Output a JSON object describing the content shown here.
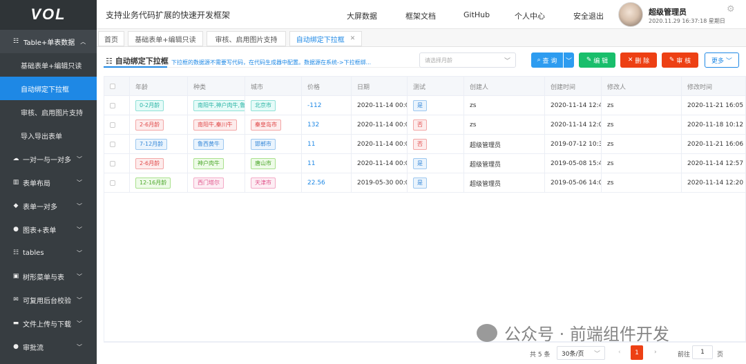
{
  "logo": "VOL",
  "sidebar": {
    "group": {
      "label": "Table+单表数据",
      "icon": "grid-icon"
    },
    "subitems": [
      "基础表单+编辑只读",
      "自动绑定下拉框",
      "审核、启用图片支持",
      "导入导出表单"
    ],
    "active_subitem": "自动绑定下拉框",
    "items": [
      {
        "label": "一对一与一对多",
        "icon": "cloud-icon"
      },
      {
        "label": "表单布局",
        "icon": "bar-chart-icon"
      },
      {
        "label": "表单一对多",
        "icon": "cube-icon"
      },
      {
        "label": "图表+表单",
        "icon": "circle-icon"
      },
      {
        "label": "tables",
        "icon": "grid-icon"
      },
      {
        "label": "树形菜单与表",
        "icon": "image-icon"
      },
      {
        "label": "可复用后台校验",
        "icon": "chat-icon"
      },
      {
        "label": "文件上传与下载",
        "icon": "folder-icon"
      },
      {
        "label": "审批流",
        "icon": "circle-icon"
      }
    ]
  },
  "header": {
    "slogan": "支持业务代码扩展的快速开发框架",
    "nav": [
      "大屏数据",
      "框架文档",
      "GitHub",
      "个人中心",
      "安全退出"
    ],
    "user_name": "超级管理员",
    "datetime": "2020.11.29 16:37:18 星期日"
  },
  "tabs": [
    {
      "label": "首页",
      "closable": false
    },
    {
      "label": "基础表单+编辑只读",
      "closable": false
    },
    {
      "label": "审核、启用图片支持",
      "closable": false
    },
    {
      "label": "自动绑定下拉框",
      "closable": true,
      "active": true
    }
  ],
  "page": {
    "title": "自动绑定下拉框",
    "description": "下拉框的数据源不需要写代码，在代码生成器中配置。数据源在系统->下拉框绑...",
    "month_placeholder": "请选择月龄"
  },
  "toolbar": {
    "search": "查 询",
    "edit": "编 辑",
    "delete": "删 除",
    "audit": "审 核",
    "more": "更多"
  },
  "colors": {
    "primary": "#1e88e5",
    "success": "#19be6b",
    "danger": "#ed4014",
    "sidebar_bg": "#373d41"
  },
  "table": {
    "columns": [
      "年龄",
      "种类",
      "城市",
      "价格",
      "日期",
      "测试",
      "创建人",
      "创建时间",
      "修改人",
      "修改时间"
    ],
    "rows": [
      {
        "age": "0-2月龄",
        "kind": "南阳牛,神户肉牛,鲁",
        "city": "北京市",
        "price": "-112",
        "date": "2020-11-14 00:00",
        "test": "是",
        "creator": "zs",
        "created": "2020-11-14 12:48",
        "modifier": "zs",
        "modified": "2020-11-21 16:05"
      },
      {
        "age": "2-6月龄",
        "kind": "南阳牛,秦川牛",
        "city": "秦皇岛市",
        "price": "132",
        "date": "2020-11-14 00:00",
        "test": "否",
        "creator": "zs",
        "created": "2020-11-14 12:04",
        "modifier": "zs",
        "modified": "2020-11-18 10:12"
      },
      {
        "age": "7-12月龄",
        "kind": "鲁西黄牛",
        "city": "邯郸市",
        "price": "11",
        "date": "2020-11-14 00:00",
        "test": "否",
        "creator": "超级管理员",
        "created": "2019-07-12 10:39",
        "modifier": "zs",
        "modified": "2020-11-21 16:06"
      },
      {
        "age": "2-6月龄",
        "kind": "神户肉牛",
        "city": "唐山市",
        "price": "11",
        "date": "2020-11-14 00:00",
        "test": "是",
        "creator": "超级管理员",
        "created": "2019-05-08 15:42",
        "modifier": "zs",
        "modified": "2020-11-14 12:57"
      },
      {
        "age": "12-16月龄",
        "kind": "西门塔尔",
        "city": "天津市",
        "price": "22.56",
        "date": "2019-05-30 00:00",
        "test": "是",
        "creator": "超级管理员",
        "created": "2019-05-06 14:06",
        "modifier": "zs",
        "modified": "2020-11-14 12:20"
      }
    ],
    "tag_colors": {
      "age": [
        "teal",
        "red",
        "blue",
        "red",
        "green"
      ],
      "kind": [
        "teal",
        "red",
        "blue",
        "green",
        "pink"
      ],
      "city": [
        "teal",
        "red",
        "blue",
        "green",
        "pink"
      ],
      "test": [
        "blue",
        "red",
        "red",
        "blue",
        "blue"
      ]
    }
  },
  "pagination": {
    "total": "共 5 条",
    "page_size": "30条/页",
    "current_page": "1",
    "goto_label": "前往",
    "goto_value": "1",
    "page_suffix": "页"
  },
  "watermark": "公众号 · 前端组件开发"
}
